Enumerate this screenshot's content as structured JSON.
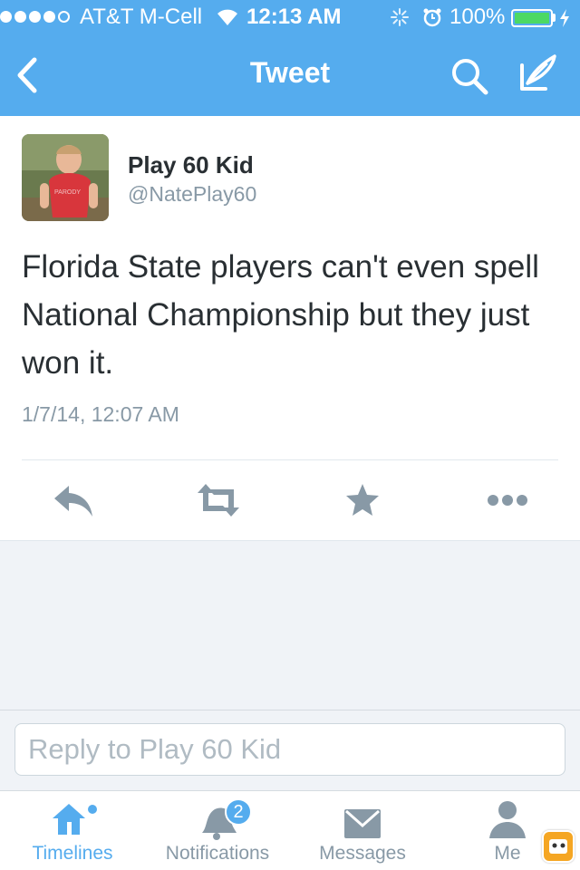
{
  "status_bar": {
    "carrier": "AT&T M-Cell",
    "time": "12:13 AM",
    "battery_percent": "100%",
    "signal_bars_filled": 4,
    "battery_level": 1.0,
    "battery_color": "#4cd964"
  },
  "nav": {
    "title": "Tweet",
    "back_icon": "chevron-left-icon",
    "search_icon": "search-icon",
    "compose_icon": "compose-icon"
  },
  "tweet": {
    "author_name": "Play 60 Kid",
    "author_handle": "@NatePlay60",
    "text": "Florida State players can't even spell National Championship but they just won it.",
    "timestamp": "1/7/14, 12:07 AM",
    "avatar_label": "PARODY",
    "actions": [
      {
        "name": "reply",
        "icon": "reply-icon"
      },
      {
        "name": "retweet",
        "icon": "retweet-icon"
      },
      {
        "name": "favorite",
        "icon": "star-icon"
      },
      {
        "name": "more",
        "icon": "more-icon"
      }
    ]
  },
  "reply": {
    "placeholder": "Reply to Play 60 Kid"
  },
  "tabs": [
    {
      "label": "Timelines",
      "icon": "home-icon",
      "active": true
    },
    {
      "label": "Notifications",
      "icon": "bell-icon",
      "badge": "2"
    },
    {
      "label": "Messages",
      "icon": "envelope-icon"
    },
    {
      "label": "Me",
      "icon": "person-icon"
    }
  ],
  "colors": {
    "brand": "#55acee",
    "text": "#292f33",
    "muted": "#8899a6",
    "action_icons": "#8899a6"
  }
}
